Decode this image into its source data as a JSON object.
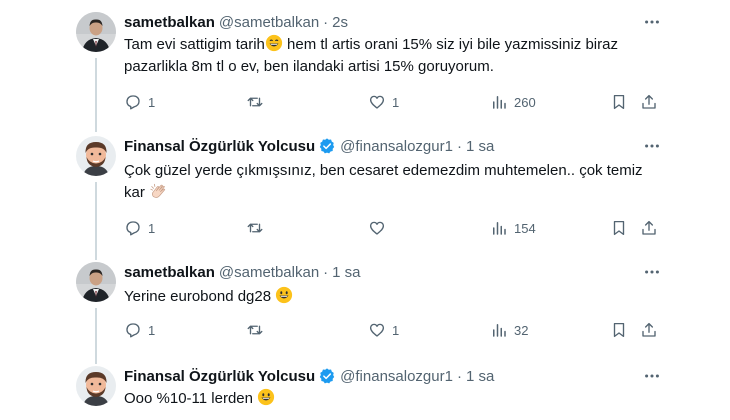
{
  "tweets": [
    {
      "name": "sametbalkan",
      "handle": "@sametbalkan",
      "separator": "·",
      "time": "2s",
      "verified": false,
      "text_part1": "Tam evi sattigim tarih",
      "text_part2": " hem tl artis orani 15% siz iyi bile yazmissiniz biraz pazarlikla 8m tl o ev, ben ilandaki artisi 15% goruyorum.",
      "emoji": "grinning-face",
      "replies": "1",
      "retweets": "",
      "likes": "1",
      "views": "260"
    },
    {
      "name": "Finansal Özgürlük Yolcusu",
      "handle": "@finansalozgur1",
      "separator": "·",
      "time": "1 sa",
      "verified": true,
      "text_part1": "Çok güzel yerde çıkmışsınız, ben cesaret edemezdim muhtemelen.. çok temiz kar",
      "text_part2": "",
      "emoji": "clapping-hands",
      "replies": "1",
      "retweets": "",
      "likes": "",
      "views": "154"
    },
    {
      "name": "sametbalkan",
      "handle": "@sametbalkan",
      "separator": "·",
      "time": "1 sa",
      "verified": false,
      "text_part1": "Yerine eurobond dg28",
      "text_part2": "",
      "emoji": "grinning-face",
      "replies": "1",
      "retweets": "",
      "likes": "1",
      "views": "32"
    },
    {
      "name": "Finansal Özgürlük Yolcusu",
      "handle": "@finansalozgur1",
      "separator": "·",
      "time": "1 sa",
      "verified": true,
      "text_part1": "Ooo %10-11 lerden",
      "text_part2": "",
      "emoji": "grinning-face",
      "replies": "",
      "retweets": "",
      "likes": "",
      "views": ""
    }
  ],
  "colors": {
    "text": "#0f1419",
    "muted": "#536471",
    "verified": "#1d9bf0",
    "thread_line": "#cfd9de"
  },
  "icons": [
    "reply-icon",
    "retweet-icon",
    "like-icon",
    "views-icon",
    "bookmark-icon",
    "share-icon",
    "more-icon",
    "verified-icon"
  ]
}
